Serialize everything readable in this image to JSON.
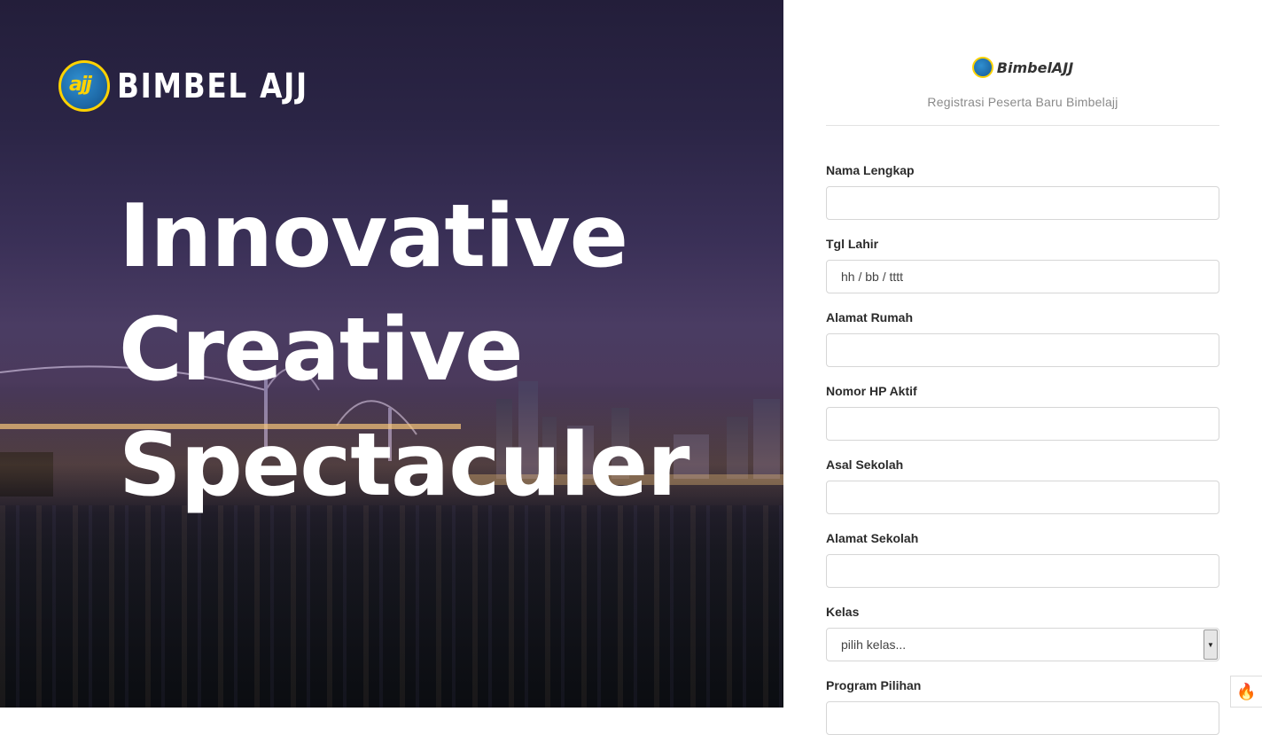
{
  "hero": {
    "brand": "BIMBEL AJJ",
    "logo_mark": "ajj",
    "headline": [
      "Innovative",
      "Creative",
      "Spectaculer"
    ]
  },
  "form": {
    "logo_text": "BimbelAJJ",
    "subtitle": "Registrasi Peserta Baru Bimbelajj",
    "fields": [
      {
        "label": "Nama Lengkap",
        "value": "",
        "placeholder": ""
      },
      {
        "label": "Tgl Lahir",
        "value": "",
        "placeholder": "hh / bb / tttt"
      },
      {
        "label": "Alamat Rumah",
        "value": "",
        "placeholder": ""
      },
      {
        "label": "Nomor HP Aktif",
        "value": "",
        "placeholder": ""
      },
      {
        "label": "Asal Sekolah",
        "value": "",
        "placeholder": ""
      },
      {
        "label": "Alamat Sekolah",
        "value": "",
        "placeholder": ""
      }
    ],
    "kelas": {
      "label": "Kelas",
      "selected": "pilih kelas..."
    },
    "program": {
      "label": "Program Pilihan"
    }
  },
  "icons": {
    "corner": "fire-icon",
    "dropdown": "chevron-down-icon"
  },
  "colors": {
    "logo_blue": "#1e6aa8",
    "logo_yellow": "#ffd200",
    "fire": "#e8452c"
  }
}
